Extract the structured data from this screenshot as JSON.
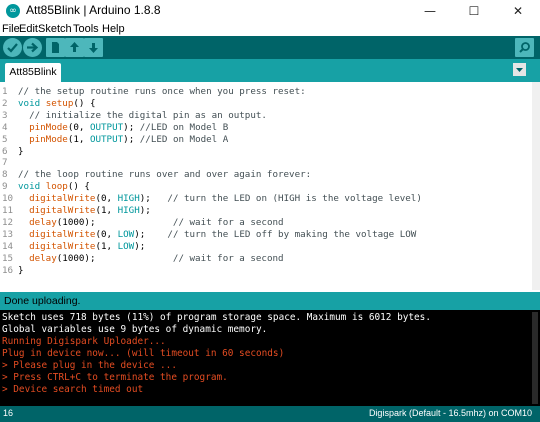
{
  "window": {
    "title": "Att85Blink | Arduino 1.8.8",
    "app_icon_glyph": "∞",
    "minimize_glyph": "—",
    "maximize_glyph": "☐",
    "close_glyph": "✕"
  },
  "menu": [
    "File",
    "Edit",
    "Sketch",
    "Tools",
    "Help"
  ],
  "toolbar": {
    "buttons": [
      "verify-icon",
      "upload-icon",
      "new-icon",
      "open-icon",
      "save-icon",
      "serial-monitor-icon"
    ]
  },
  "tabs": [
    {
      "label": "Att85Blink"
    }
  ],
  "editor": {
    "lines": [
      {
        "n": "1",
        "parts": [
          [
            "cm",
            "// the setup routine runs once when you press reset:"
          ]
        ]
      },
      {
        "n": "2",
        "parts": [
          [
            "kw",
            "void"
          ],
          [
            "",
            " "
          ],
          [
            "fn",
            "setup"
          ],
          [
            "",
            "() {"
          ]
        ]
      },
      {
        "n": "3",
        "parts": [
          [
            "cm",
            "  // initialize the digital pin as an output."
          ]
        ]
      },
      {
        "n": "4",
        "parts": [
          [
            "",
            "  "
          ],
          [
            "fn",
            "pinMode"
          ],
          [
            "",
            "(0, "
          ],
          [
            "kw",
            "OUTPUT"
          ],
          [
            "",
            "); "
          ],
          [
            "cm",
            "//LED on Model B"
          ]
        ]
      },
      {
        "n": "5",
        "parts": [
          [
            "",
            "  "
          ],
          [
            "fn",
            "pinMode"
          ],
          [
            "",
            "(1, "
          ],
          [
            "kw",
            "OUTPUT"
          ],
          [
            "",
            "); "
          ],
          [
            "cm",
            "//LED on Model A"
          ]
        ]
      },
      {
        "n": "6",
        "parts": [
          [
            "",
            "}"
          ]
        ]
      },
      {
        "n": "7",
        "parts": [
          [
            "",
            ""
          ]
        ]
      },
      {
        "n": "8",
        "parts": [
          [
            "cm",
            "// the loop routine runs over and over again forever:"
          ]
        ]
      },
      {
        "n": "9",
        "parts": [
          [
            "kw",
            "void"
          ],
          [
            "",
            " "
          ],
          [
            "fn",
            "loop"
          ],
          [
            "",
            "() {"
          ]
        ]
      },
      {
        "n": "10",
        "parts": [
          [
            "",
            "  "
          ],
          [
            "fn",
            "digitalWrite"
          ],
          [
            "",
            "(0, "
          ],
          [
            "kw",
            "HIGH"
          ],
          [
            "",
            ");   "
          ],
          [
            "cm",
            "// turn the LED on (HIGH is the voltage level)"
          ]
        ]
      },
      {
        "n": "11",
        "parts": [
          [
            "",
            "  "
          ],
          [
            "fn",
            "digitalWrite"
          ],
          [
            "",
            "(1, "
          ],
          [
            "kw",
            "HIGH"
          ],
          [
            "",
            ");"
          ]
        ]
      },
      {
        "n": "12",
        "parts": [
          [
            "",
            "  "
          ],
          [
            "fn",
            "delay"
          ],
          [
            "",
            "(1000);              "
          ],
          [
            "cm",
            "// wait for a second"
          ]
        ]
      },
      {
        "n": "13",
        "parts": [
          [
            "",
            "  "
          ],
          [
            "fn",
            "digitalWrite"
          ],
          [
            "",
            "(0, "
          ],
          [
            "kw",
            "LOW"
          ],
          [
            "",
            ");    "
          ],
          [
            "cm",
            "// turn the LED off by making the voltage LOW"
          ]
        ]
      },
      {
        "n": "14",
        "parts": [
          [
            "",
            "  "
          ],
          [
            "fn",
            "digitalWrite"
          ],
          [
            "",
            "(1, "
          ],
          [
            "kw",
            "LOW"
          ],
          [
            "",
            ");"
          ]
        ]
      },
      {
        "n": "15",
        "parts": [
          [
            "",
            "  "
          ],
          [
            "fn",
            "delay"
          ],
          [
            "",
            "(1000);              "
          ],
          [
            "cm",
            "// wait for a second"
          ]
        ]
      },
      {
        "n": "16",
        "parts": [
          [
            "",
            "}"
          ]
        ]
      }
    ]
  },
  "status": {
    "message": "Done uploading."
  },
  "console": {
    "lines": [
      {
        "color": "white",
        "text": "Sketch uses 718 bytes (11%) of program storage space. Maximum is 6012 bytes."
      },
      {
        "color": "white",
        "text": "Global variables use 9 bytes of dynamic memory."
      },
      {
        "color": "red",
        "text": "Running Digispark Uploader..."
      },
      {
        "color": "red",
        "text": "Plug in device now... (will timeout in 60 seconds)"
      },
      {
        "color": "red",
        "text": "> Please plug in the device ..."
      },
      {
        "color": "red",
        "text": "> Press CTRL+C to terminate the program."
      },
      {
        "color": "red",
        "text": "> Device search timed out"
      }
    ]
  },
  "bottom": {
    "line_number": "16",
    "board_info": "Digispark (Default - 16.5mhz) on COM10"
  },
  "colors": {
    "toolbar": "#006468",
    "tabbar": "#17a1a5",
    "keyword": "#00979c",
    "function": "#d35400",
    "console_error": "#e34c22"
  }
}
